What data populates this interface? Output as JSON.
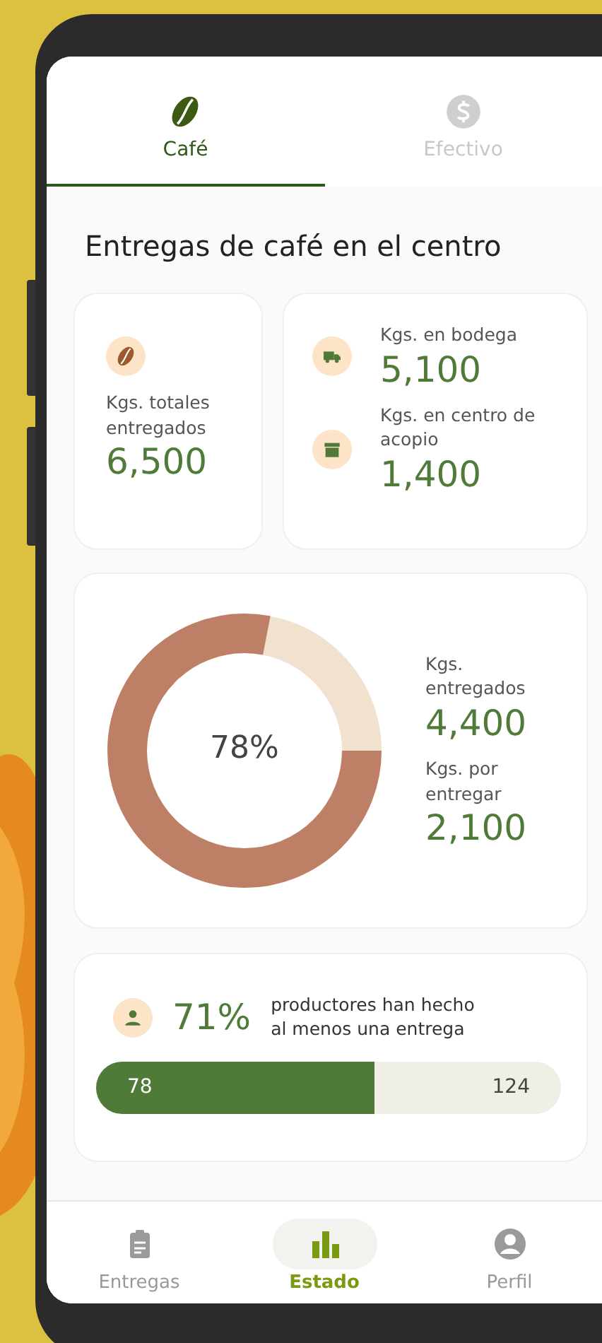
{
  "tabs": [
    {
      "label": "Café",
      "kind": "bean",
      "selected": true
    },
    {
      "label": "Efectivo",
      "kind": "dollar",
      "selected": false
    }
  ],
  "title": "Entregas de café en el centro",
  "total_card": {
    "label": "Kgs. totales entregados",
    "value": "6,500"
  },
  "storage": [
    {
      "label": "Kgs. en bodega",
      "value": "5,100",
      "kind": "truck"
    },
    {
      "label": "Kgs. en centro de acopio",
      "value": "1,400",
      "kind": "box"
    }
  ],
  "donut": {
    "level": 0.78,
    "reading": "78%",
    "legend": [
      {
        "label": "Kgs. entregados",
        "value": "4,400"
      },
      {
        "label": "Kgs. por entregar",
        "value": "2,100"
      }
    ]
  },
  "producers": {
    "percent": "71%",
    "text": "productores han hecho al menos una entrega",
    "level": 0.6,
    "done": "78",
    "total": "124"
  },
  "nav": [
    {
      "label": "Entregas",
      "kind": "clipboard",
      "selected": false
    },
    {
      "label": "Estado",
      "kind": "chart",
      "selected": true
    },
    {
      "label": "Perfil",
      "kind": "person",
      "selected": false
    }
  ]
}
